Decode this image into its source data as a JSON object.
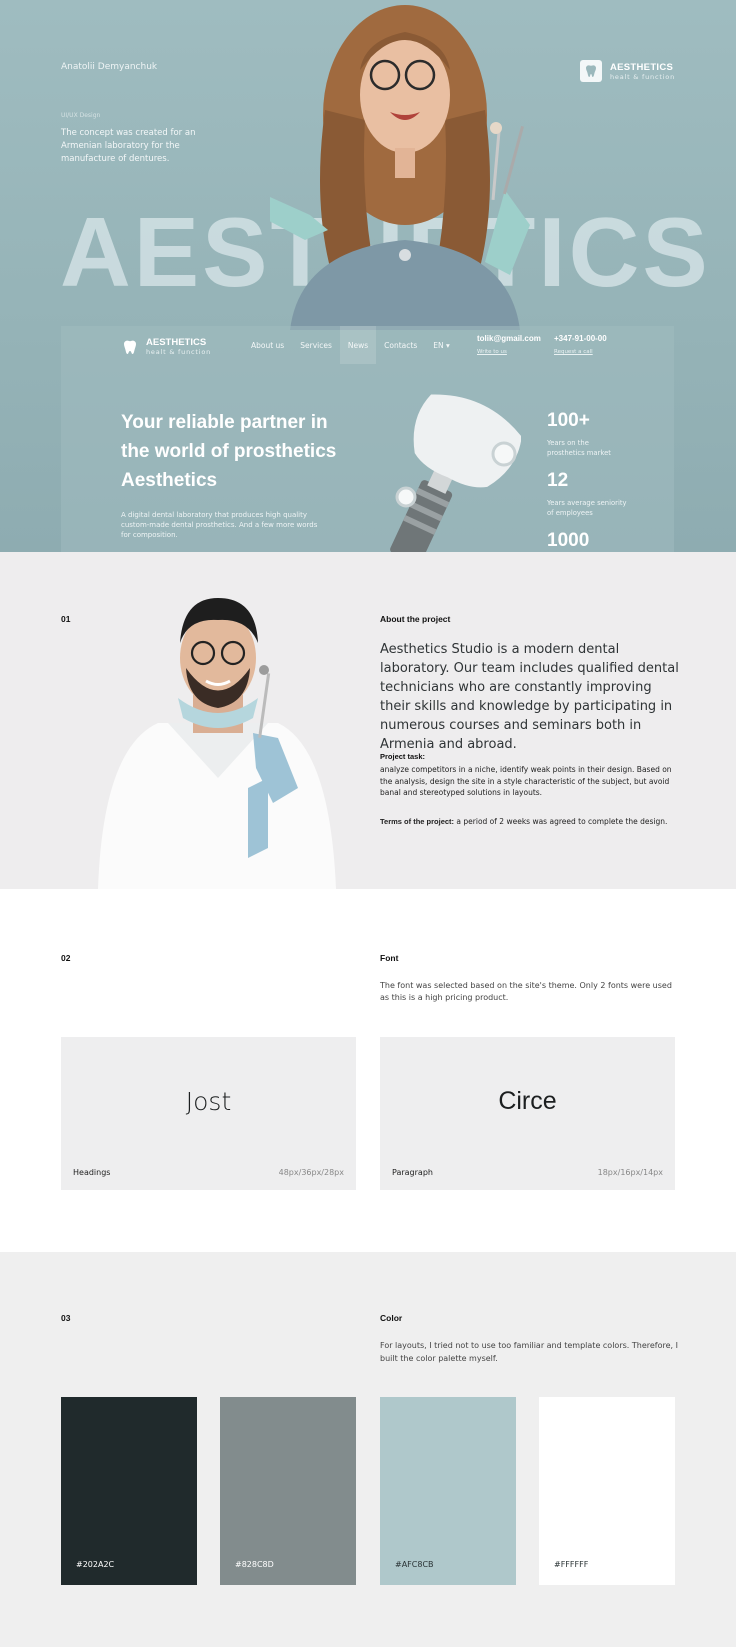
{
  "hero": {
    "author": "Anatolii Demyanchuk",
    "tagline": "UI/UX Design",
    "description": "The concept was created for an Armenian laboratory for the manufacture of dentures.",
    "brand_name": "AESTHETICS",
    "brand_sub": "healt & function",
    "big_word": "AESTHETICS"
  },
  "site_mock": {
    "logo_name": "AESTHETICS",
    "logo_sub": "healt & function",
    "nav": [
      "About us",
      "Services",
      "News",
      "Contacts",
      "EN ▾"
    ],
    "active_nav": "News",
    "email": "tolik@gmail.com",
    "email_link": "Write to us",
    "phone": "+347-91-00-00",
    "phone_link": "Request a call",
    "title": "Your reliable partner in the world of prosthetics Aesthetics",
    "description": "A digital dental laboratory that produces high quality custom-made dental prosthetics. And a few more words for composition.",
    "stats": [
      {
        "value": "100+",
        "label": "Years on the prosthetics market"
      },
      {
        "value": "12",
        "label": "Years average seniority of employees"
      },
      {
        "value": "1000",
        "label": ""
      }
    ]
  },
  "about": {
    "number": "01",
    "heading": "About the project",
    "lead": "Aesthetics Studio is a modern dental laboratory. Our team includes qualified dental technicians who are constantly improving their skills and knowledge by participating in numerous courses and seminars both in Armenia and abroad.",
    "task_heading": "Project task:",
    "task_text": "analyze competitors in a niche, identify weak points in their design. Based on the analysis, design the site in a style characteristic of the subject, but avoid banal and stereotyped solutions in layouts.",
    "terms_label": "Terms of the project:",
    "terms_text": " a period of 2 weeks was agreed to complete the design."
  },
  "font": {
    "number": "02",
    "heading": "Font",
    "description": "The font was selected based on the site's theme. Only 2 fonts were used as this is a high pricing product.",
    "cards": [
      {
        "sample": "Jost",
        "label": "Headings",
        "sizes": "48px/36px/28px"
      },
      {
        "sample": "Circe",
        "label": "Paragraph",
        "sizes": "18px/16px/14px"
      }
    ]
  },
  "color": {
    "number": "03",
    "heading": "Color",
    "description": "For layouts, I tried not to use too familiar and template colors. Therefore, I built the color palette myself.",
    "swatches": [
      {
        "hex": "#202A2C",
        "label": "#202A2C"
      },
      {
        "hex": "#828C8D",
        "label": "#828C8D"
      },
      {
        "hex": "#AFC8CB",
        "label": "#AFC8CB"
      },
      {
        "hex": "#FFFFFF",
        "label": "#FFFFFF"
      }
    ]
  }
}
